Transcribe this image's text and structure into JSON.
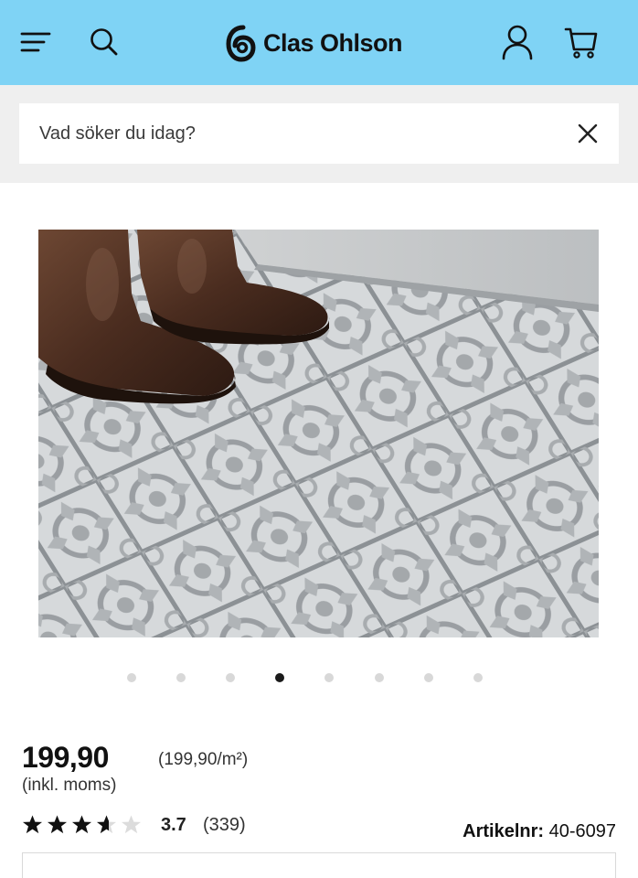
{
  "header": {
    "brand": "Clas Ohlson",
    "icons": [
      "menu-icon",
      "search-icon",
      "clas-ohlson-logo-icon",
      "account-icon",
      "cart-icon"
    ],
    "background_color": "#7fd3f5"
  },
  "search": {
    "placeholder": "Vad söker du idag?",
    "value": ""
  },
  "gallery": {
    "image_count": 8,
    "active_index": 3
  },
  "product": {
    "price": "199,90",
    "unit_price": "(199,90/m²)",
    "vat_note": "(inkl. moms)",
    "rating": {
      "value": "3.7",
      "count": "(339)",
      "stars_filled": 3.7,
      "stars_total": 5
    },
    "article_label": "Artikelnr:",
    "article_number": "40-6097"
  }
}
